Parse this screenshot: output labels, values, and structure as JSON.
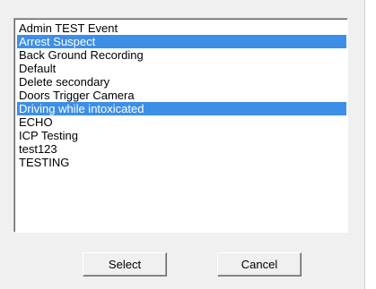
{
  "list": {
    "items": [
      {
        "label": "Admin TEST Event",
        "selected": false
      },
      {
        "label": "Arrest Suspect",
        "selected": true
      },
      {
        "label": "Back Ground Recording",
        "selected": false
      },
      {
        "label": "Default",
        "selected": false
      },
      {
        "label": "Delete secondary",
        "selected": false
      },
      {
        "label": "Doors Trigger Camera",
        "selected": false
      },
      {
        "label": "Driving while intoxicated",
        "selected": true
      },
      {
        "label": "ECHO",
        "selected": false
      },
      {
        "label": "ICP Testing",
        "selected": false
      },
      {
        "label": "test123",
        "selected": false
      },
      {
        "label": "TESTING",
        "selected": false
      }
    ]
  },
  "buttons": {
    "select_label": "Select",
    "cancel_label": "Cancel"
  },
  "colors": {
    "selection": "#3d8ee6",
    "dialog_bg": "#f0f0f0"
  }
}
